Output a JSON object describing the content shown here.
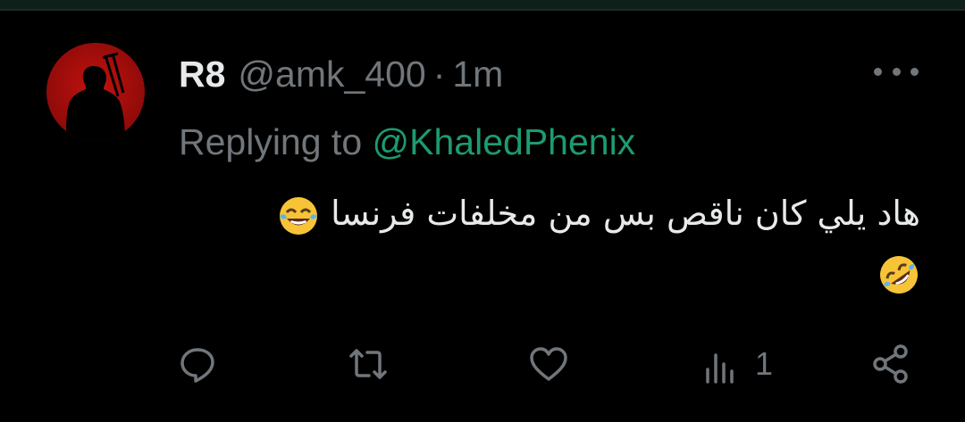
{
  "tweet": {
    "display_name": "R8",
    "handle": "@amk_400",
    "separator": "·",
    "time": "1m",
    "replying_prefix": "Replying to",
    "replying_to": "@KhaledPhenix",
    "text_line1": "هاد يلي كان ناقص بس من مخلفات فرنسا",
    "emoji_line1": "face-with-tears-of-joy",
    "emoji_line2": "rolling-on-the-floor-laughing"
  },
  "actions": {
    "views_count": "1"
  },
  "colors": {
    "background": "#000000",
    "text": "#e7e9ea",
    "muted": "#71767b",
    "mention": "#1d9b6f",
    "avatar_red": "#c2120f"
  },
  "icons": [
    "reply-icon",
    "retweet-icon",
    "like-icon",
    "views-icon",
    "share-icon",
    "more-icon"
  ]
}
